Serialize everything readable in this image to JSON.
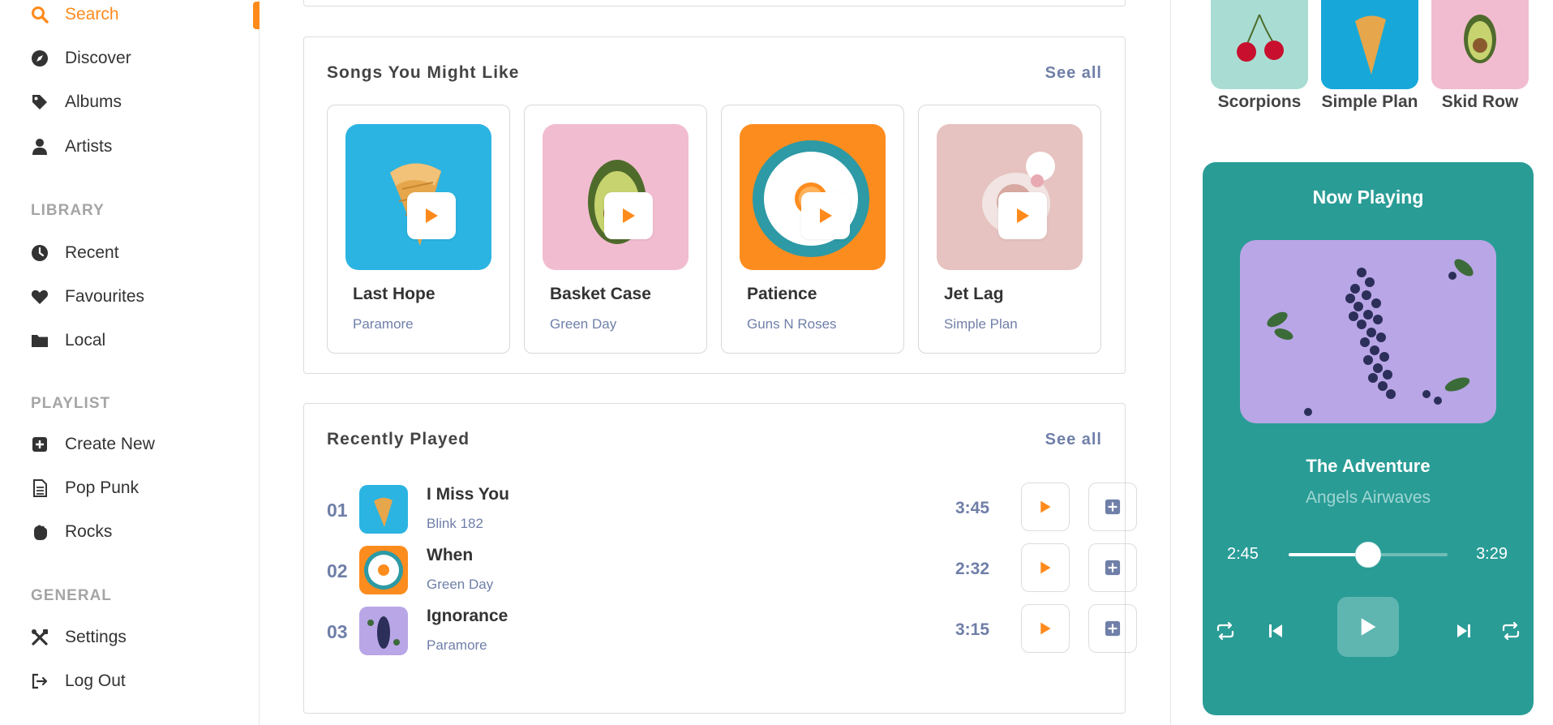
{
  "theme": {
    "accent": "#ff8a1c",
    "muted_text": "#6f7fa8",
    "player_bg": "#2a9c96"
  },
  "sidebar": {
    "top_items": [
      {
        "label": "Search",
        "icon": "search-icon",
        "active": true
      },
      {
        "label": "Discover",
        "icon": "compass-icon"
      },
      {
        "label": "Albums",
        "icon": "tag-icon"
      },
      {
        "label": "Artists",
        "icon": "user-icon"
      }
    ],
    "library": {
      "label": "LIBRARY",
      "items": [
        {
          "label": "Recent",
          "icon": "clock-icon"
        },
        {
          "label": "Favourites",
          "icon": "heart-icon"
        },
        {
          "label": "Local",
          "icon": "folder-icon"
        }
      ]
    },
    "playlist": {
      "label": "PLAYLIST",
      "items": [
        {
          "label": "Create New",
          "icon": "plus-square-icon"
        },
        {
          "label": "Pop Punk",
          "icon": "file-icon"
        },
        {
          "label": "Rocks",
          "icon": "hand-icon"
        }
      ]
    },
    "general": {
      "label": "GENERAL",
      "items": [
        {
          "label": "Settings",
          "icon": "tools-icon"
        },
        {
          "label": "Log Out",
          "icon": "logout-icon"
        }
      ]
    }
  },
  "songs_section": {
    "title": "Songs You Might Like",
    "see_all": "See all",
    "songs": [
      {
        "title": "Last Hope",
        "artist": "Paramore",
        "art": "ice-cream-cone"
      },
      {
        "title": "Basket Case",
        "artist": "Green Day",
        "art": "avocado"
      },
      {
        "title": "Patience",
        "artist": "Guns N Roses",
        "art": "orange-on-plate"
      },
      {
        "title": "Jet Lag",
        "artist": "Simple Plan",
        "art": "coffee-cup-flowers"
      }
    ]
  },
  "recent_section": {
    "title": "Recently Played",
    "see_all": "See all",
    "rows": [
      {
        "num": "01",
        "title": "I Miss You",
        "artist": "Blink 182",
        "duration": "3:45"
      },
      {
        "num": "02",
        "title": "When",
        "artist": "Green Day",
        "duration": "2:32"
      },
      {
        "num": "03",
        "title": "Ignorance",
        "artist": "Paramore",
        "duration": "3:15"
      }
    ]
  },
  "artists": [
    {
      "name": "Scorpions"
    },
    {
      "name": "Simple Plan"
    },
    {
      "name": "Skid Row"
    }
  ],
  "player": {
    "heading": "Now Playing",
    "song": "The Adventure",
    "artist": "Angels Airwaves",
    "current_time": "2:45",
    "duration": "3:29",
    "progress": 0.5
  }
}
